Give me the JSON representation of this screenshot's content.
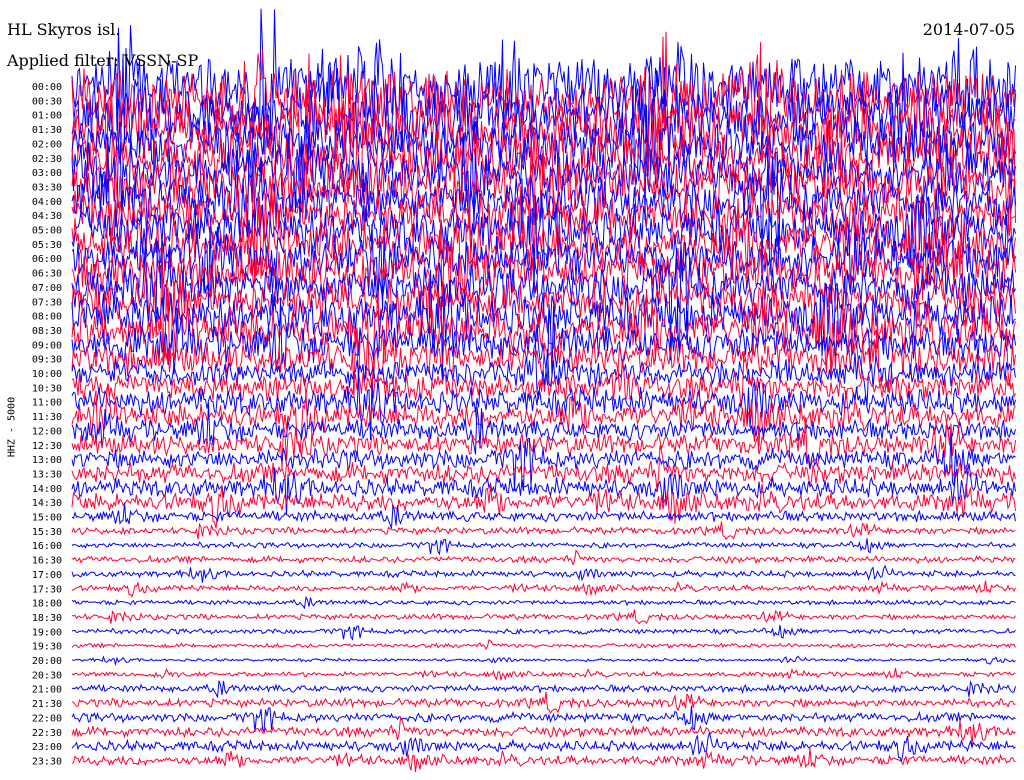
{
  "header": {
    "station": "HL Skyros isl.",
    "date": "2014-07-05",
    "filter": "Applied filter: VSSN-SP"
  },
  "chart_data": {
    "type": "line",
    "title": "HL Skyros isl.",
    "date": "2014-07-05",
    "ylabel": "HHZ - 5000",
    "row_labels": [
      "00:00",
      "00:30",
      "01:00",
      "01:30",
      "02:00",
      "02:30",
      "03:00",
      "03:30",
      "04:00",
      "04:30",
      "05:00",
      "05:30",
      "06:00",
      "06:30",
      "07:00",
      "07:30",
      "08:00",
      "08:30",
      "09:00",
      "09:30",
      "10:00",
      "10:30",
      "11:00",
      "11:30",
      "12:00",
      "12:30",
      "13:00",
      "13:30",
      "14:00",
      "14:30",
      "15:00",
      "15:30",
      "16:00",
      "16:30",
      "17:00",
      "17:30",
      "18:00",
      "18:30",
      "19:00",
      "19:30",
      "20:00",
      "20:30",
      "21:00",
      "21:30",
      "22:00",
      "22:30",
      "23:00",
      "23:30"
    ],
    "series_colors": [
      "#0000ff",
      "#ff0033"
    ],
    "relative_amplitude": [
      1.0,
      1.0,
      0.95,
      0.95,
      0.9,
      0.9,
      0.88,
      0.85,
      0.82,
      0.8,
      0.8,
      0.78,
      0.78,
      0.76,
      0.75,
      0.74,
      0.72,
      0.7,
      0.6,
      0.55,
      0.45,
      0.45,
      0.45,
      0.42,
      0.35,
      0.35,
      0.35,
      0.35,
      0.32,
      0.3,
      0.22,
      0.15,
      0.12,
      0.14,
      0.13,
      0.12,
      0.1,
      0.12,
      0.11,
      0.09,
      0.06,
      0.1,
      0.15,
      0.18,
      0.2,
      0.22,
      0.22,
      0.2
    ],
    "grid": false,
    "legend": "none"
  }
}
